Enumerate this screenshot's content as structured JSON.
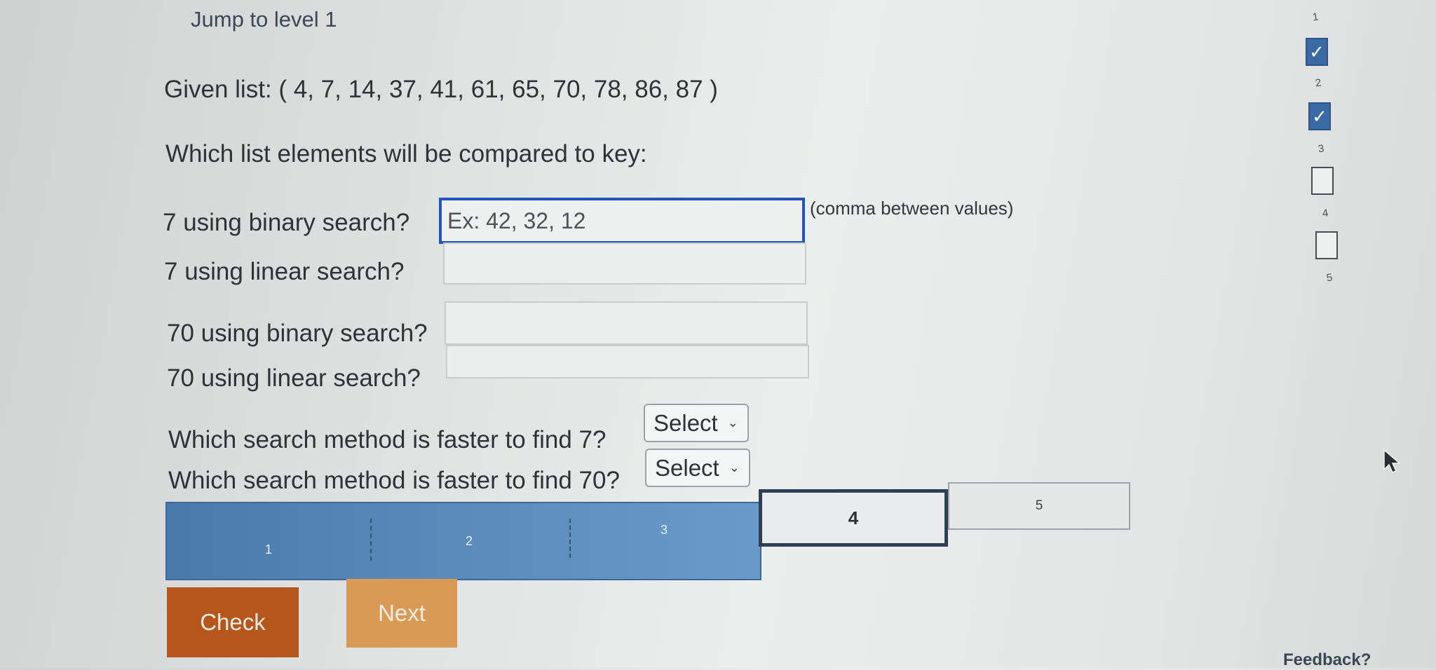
{
  "jump": {
    "label": "Jump to level 1"
  },
  "given_list": "Given list: ( 4, 7, 14, 37, 41, 61, 65, 70, 78, 86, 87 )",
  "prompt": "Which list elements will be compared to key:",
  "questions": [
    {
      "label": "7 using binary search?",
      "value": "",
      "placeholder": "Ex: 42, 32, 12"
    },
    {
      "label": "7 using linear search?",
      "value": "",
      "placeholder": ""
    },
    {
      "label": "70 using binary search?",
      "value": "",
      "placeholder": ""
    },
    {
      "label": "70 using linear search?",
      "value": "",
      "placeholder": ""
    }
  ],
  "input_hint": "(comma between values)",
  "selects": [
    {
      "label": "Which search method is faster to find 7?",
      "selected": "Select"
    },
    {
      "label": "Which search method is faster to find 70?",
      "selected": "Select"
    }
  ],
  "progress": {
    "segments": [
      "1",
      "2",
      "3",
      "4",
      "5"
    ],
    "current": "4",
    "completed_count": 3
  },
  "buttons": {
    "check": "Check",
    "next": "Next"
  },
  "level_nav": {
    "levels": [
      "1",
      "2",
      "3",
      "4",
      "5"
    ],
    "completed": [
      true,
      true,
      false,
      false,
      false
    ]
  },
  "feedback": "Feedback?",
  "colors": {
    "check_button": "#b5561a",
    "next_button": "#d99a55",
    "progress_blue": "#5b8bbb",
    "focus_border": "#1f56b8"
  }
}
